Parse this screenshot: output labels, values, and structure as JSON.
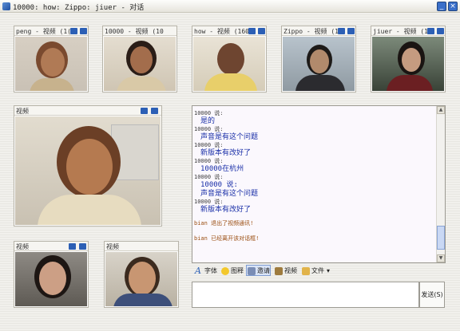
{
  "window": {
    "title": "10000: how: Zippo: jiuer - 对话",
    "minimize_glyph": "_",
    "close_glyph": "×"
  },
  "video_tiles": [
    {
      "label": "peng - 视频 (1("
    },
    {
      "label": "10000 - 视频 (10"
    },
    {
      "label": "how - 视频 (160"
    },
    {
      "label": "Zippo - 视频 (1"
    },
    {
      "label": "jiuer - 视频 (1"
    }
  ],
  "main_video": {
    "label": "视频"
  },
  "small_videos": [
    {
      "label": "视频"
    },
    {
      "label": "视频"
    }
  ],
  "chat": {
    "messages": [
      {
        "sender": "10000  说:",
        "text": "是的"
      },
      {
        "sender": "10000  说:",
        "text": "声音是有这个问题"
      },
      {
        "sender": "10000  说:",
        "text": "新版本有改好了"
      },
      {
        "sender": "10000  说:",
        "text": "10000在杭州"
      },
      {
        "sender": "10000  说:",
        "text": "10000  说:"
      },
      {
        "sender": "",
        "text": "声音是有这个问题"
      },
      {
        "sender": "10000  说:",
        "text": "新版本有改好了"
      }
    ],
    "system": [
      "bian 退出了视频通讯!",
      "bian 已经离开该对话框!"
    ]
  },
  "toolbar": {
    "font_label": "字体",
    "emoticon_label": "图释",
    "invite_label": "邀请",
    "video_label": "视频",
    "file_label": "文件",
    "more_glyph": "▾"
  },
  "send": {
    "label": "发送(S)"
  },
  "colors": {
    "accent": "#2c5fb5",
    "message_text": "#1a2fa8",
    "system_text": "#9a4d10"
  },
  "icons": [
    "app-icon",
    "speaker-icon",
    "camera-icon",
    "font-icon",
    "emoticon-icon",
    "invite-icon",
    "video-icon",
    "file-icon"
  ]
}
